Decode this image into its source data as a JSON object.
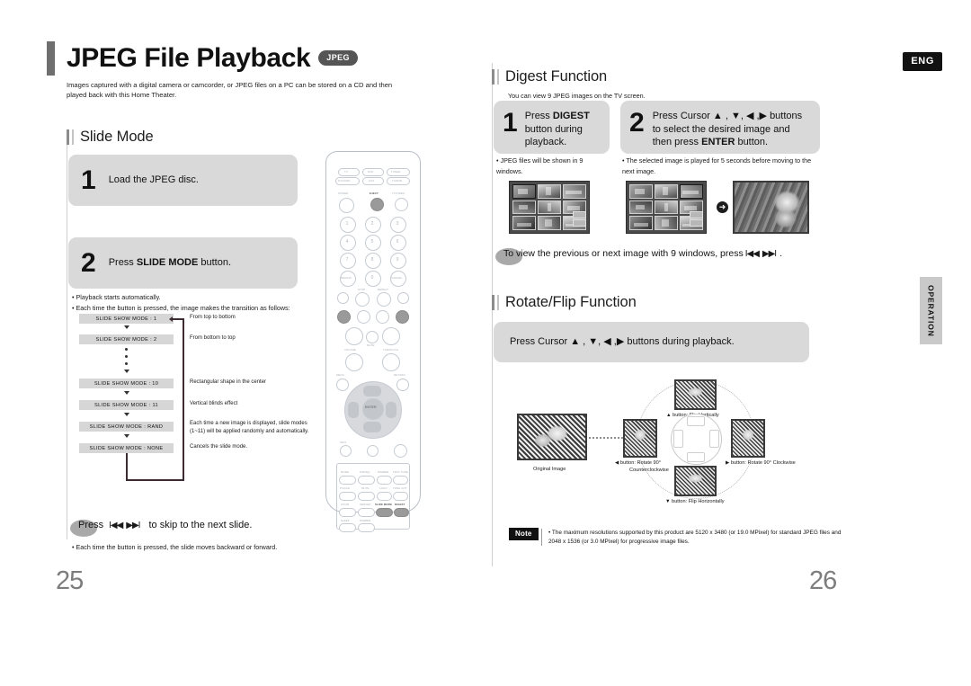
{
  "header": {
    "title": "JPEG File Playback",
    "format_badge": "JPEG",
    "intro": "Images captured with a digital camera or camcorder, or JPEG files on a PC can be stored on a CD and then played back with this Home Theater.",
    "language_badge": "ENG"
  },
  "side_tab": {
    "label": "OPERATION"
  },
  "left_column": {
    "section_title": "Slide Mode",
    "steps": [
      {
        "number": "1",
        "text": "Load the JPEG disc."
      },
      {
        "number": "2",
        "text_before": "Press ",
        "text_bold": "SLIDE MODE",
        "text_after": " button."
      }
    ],
    "bullets": [
      "Playback starts automatically.",
      "Each time the button is pressed, the image makes the transition as follows:"
    ],
    "flow_chart": {
      "rows": [
        {
          "chip": "SLIDE SHOW MODE : 1",
          "desc": "From top to bottom"
        },
        {
          "chip": "SLIDE SHOW MODE : 2",
          "desc": "From bottom to top"
        },
        {
          "chip": "SLIDE SHOW MODE : 10",
          "desc": "Rectangular shape in the center"
        },
        {
          "chip": "SLIDE SHOW MODE : 11",
          "desc": "Vertical blinds effect"
        },
        {
          "chip": "SLIDE SHOW MODE : RAND",
          "desc": "Each time a new image is displayed, slide modes (1~11) will be applied randomly and automatically."
        },
        {
          "chip": "SLIDE SHOW MODE : NONE",
          "desc": "Cancels the slide mode."
        }
      ]
    },
    "footer_tip": {
      "press_label": "Press",
      "glyph_prev": "I◀◀",
      "glyph_next": "▶▶I",
      "text": "to skip to the next slide.",
      "bullet": "Each time the button is pressed, the slide moves backward or forward."
    }
  },
  "right_column": {
    "digest": {
      "section_title": "Digest Function",
      "subtitle": "You can view 9 JPEG images on the TV screen.",
      "steps": [
        {
          "number": "1",
          "line1_before": "Press ",
          "line1_bold": "DIGEST",
          "line2": "button during",
          "line3": "playback.",
          "bullet": "JPEG files will be shown in 9 windows."
        },
        {
          "number": "2",
          "line1": "Press Cursor ▲ , ▼, ◀ ,▶ buttons",
          "line2": "to select the desired image and",
          "line3_before": "then press ",
          "line3_bold": "ENTER",
          "line3_after": " button.",
          "bullet": "The selected image is played for 5 seconds before moving to the next image."
        }
      ],
      "tip": {
        "text_before": "To view the previous or next image with 9 windows, press ",
        "glyph_prev": "I◀◀",
        "glyph_next": "▶▶I",
        "text_after": " ."
      }
    },
    "rotate_flip": {
      "section_title": "Rotate/Flip Function",
      "instruction": "Press Cursor ▲ , ▼, ◀ ,▶  buttons during playback.",
      "original_label": "Original Image",
      "labels": {
        "up": "▲ button: Flip Vertically",
        "down": "▼ button: Flip Horizontally",
        "left_line1": "◀ button: Rotate 90°",
        "left_line2": "Counterclockwise",
        "right": "▶ button: Rotate 90° Clockwise"
      }
    },
    "note": {
      "tag": "Note",
      "text": "The maximum resolutions supported by this product are 5120 x 3480 (or 19.0 MPixel) for standard JPEG files and 2048 x 1536 (or 3.0 MPixel) for progressive image files."
    }
  },
  "remote": {
    "top_buttons": [
      "TV",
      "DVD",
      "TUNER",
      "P.SOUND",
      "AUX",
      "TV/DVD"
    ],
    "power_label": "POWER",
    "eject_label": "EJECT",
    "tv_video_label": "TV/VIDEO",
    "numbers": [
      "1",
      "2",
      "3",
      "4",
      "5",
      "6",
      "7",
      "8",
      "9"
    ],
    "num_extra": [
      "REMAIN",
      "0",
      "CANCEL"
    ],
    "transport_labels": [
      "STOP",
      "REPEAT"
    ],
    "volume_label": "VOLUME",
    "mute_label": "MUTE",
    "tuning_label": "TUNING/CH",
    "menu_label": "MENU",
    "return_label": "RETURN",
    "enter_label": "ENTER",
    "info_label": "INFO",
    "bottom_grid": [
      [
        "MODE",
        "DSP/EQ",
        "DIMMER",
        "TEST TONE"
      ],
      [
        "P.SCAN",
        "MUTE",
        "LOGO",
        "TONE CNT"
      ],
      [
        "ZOOM",
        "SERVER",
        "SLIDE MODE",
        "DIGEST"
      ],
      [
        "SLEEP",
        "DIMMER",
        "",
        ""
      ]
    ],
    "highlighted": [
      "SLIDE MODE",
      "DIGEST"
    ]
  },
  "pages": {
    "left": "25",
    "right": "26"
  }
}
